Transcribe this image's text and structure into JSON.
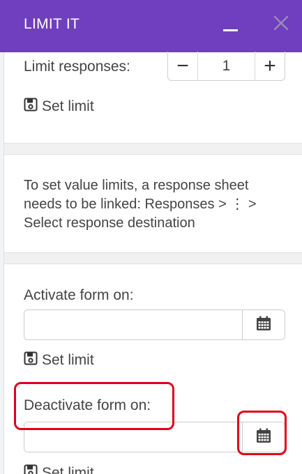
{
  "header": {
    "title": "LIMIT IT"
  },
  "responses_section": {
    "label": "Limit responses:",
    "stepper": {
      "minus_label": "−",
      "value": "1",
      "plus_label": "+"
    },
    "set_limit_label": "Set limit"
  },
  "value_limits_section": {
    "info_text": "To set value limits, a response sheet needs to be linked: Responses > ⋮ > Select response destination"
  },
  "date_section": {
    "activate_label": "Activate form on:",
    "activate_value": "",
    "activate_set_limit_label": "Set limit",
    "deactivate_label": "Deactivate form on:",
    "deactivate_value": "",
    "deactivate_set_limit_label": "Set limit"
  },
  "icons": {
    "minimize": "minimize-icon",
    "close": "close-icon",
    "save": "save-icon",
    "calendar": "calendar-icon"
  },
  "colors": {
    "header_bg": "#6f3fbf",
    "highlight": "#e0001a",
    "text": "#444444"
  }
}
